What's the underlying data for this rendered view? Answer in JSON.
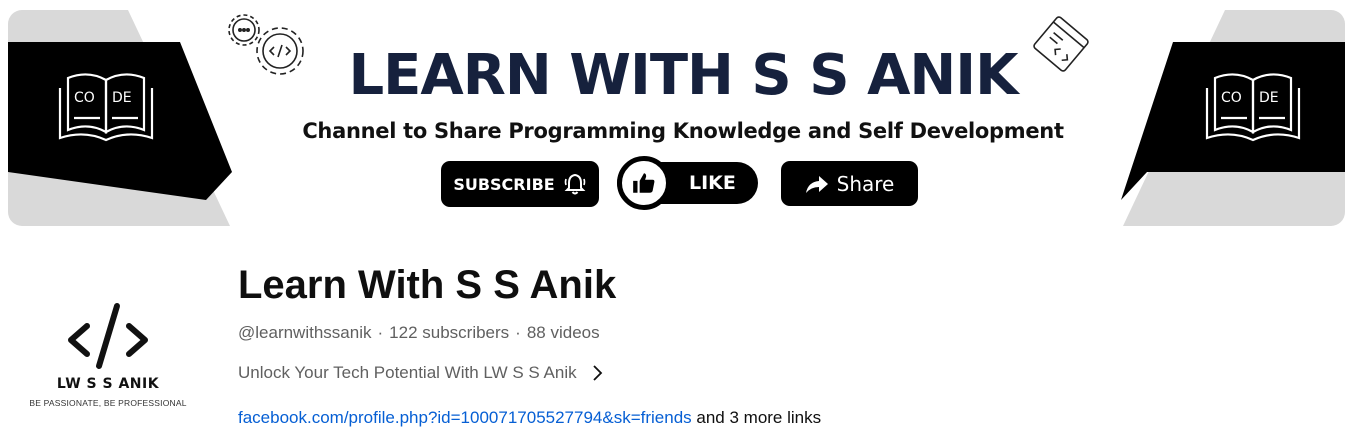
{
  "banner": {
    "title": "LEARN WITH S S ANIK",
    "subtitle": "Channel to Share Programming Knowledge and Self Development",
    "subscribe_label": "SUBSCRIBE",
    "like_label": "LIKE",
    "share_label": "Share",
    "book_left_text_1": "CO",
    "book_left_text_2": "DE",
    "book_right_text_1": "CO",
    "book_right_text_2": "DE",
    "gear_icon": "gear-code-icon",
    "browser_icon": "code-window-icon"
  },
  "avatar": {
    "code_symbol": "</>",
    "name": "LW S S ANIK",
    "tagline": "BE PASSIONATE, BE PROFESSIONAL"
  },
  "channel": {
    "title": "Learn With S S Anik",
    "handle": "@learnwithssanik",
    "subscribers": "122 subscribers",
    "videos": "88 videos",
    "separator": "·",
    "description": "Unlock Your Tech Potential With LW S S Anik",
    "link_text": "facebook.com/profile.php?id=100071705527794&sk=friends",
    "more_links": " and 3 more links"
  },
  "colors": {
    "title_navy": "#16213d",
    "link_blue": "#065fd4",
    "meta_gray": "#606060",
    "panel_gray": "#d9d9d9"
  }
}
